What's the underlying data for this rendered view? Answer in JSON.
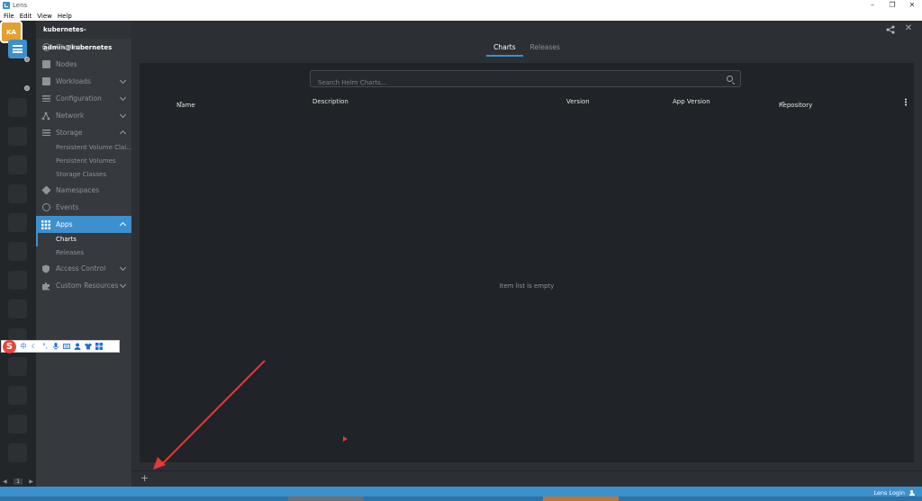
{
  "window": {
    "title": "Lens",
    "controls": {
      "minimize": "–",
      "maximize": "❐",
      "close": "✕"
    }
  },
  "menubar": [
    "File",
    "Edit",
    "View",
    "Help"
  ],
  "hotbar": {
    "cluster_badge": "KA",
    "pager": {
      "prev": "◀",
      "page": "1",
      "next": "▶"
    }
  },
  "sidebar": {
    "cluster_name": "kubernetes-admin@kubernetes",
    "items": [
      {
        "label": "Cluster",
        "icon": "cluster-icon"
      },
      {
        "label": "Nodes",
        "icon": "nodes-icon"
      },
      {
        "label": "Workloads",
        "icon": "workloads-icon",
        "expandable": true
      },
      {
        "label": "Configuration",
        "icon": "configuration-icon",
        "expandable": true
      },
      {
        "label": "Network",
        "icon": "network-icon",
        "expandable": true
      },
      {
        "label": "Storage",
        "icon": "storage-icon",
        "expanded": true,
        "children": [
          "Persistent Volume Clai...",
          "Persistent Volumes",
          "Storage Classes"
        ]
      },
      {
        "label": "Namespaces",
        "icon": "namespaces-icon"
      },
      {
        "label": "Events",
        "icon": "events-icon"
      },
      {
        "label": "Apps",
        "icon": "apps-icon",
        "expanded": true,
        "active": true,
        "children": [
          "Charts",
          "Releases"
        ]
      },
      {
        "label": "Access Control",
        "icon": "access-control-icon",
        "expandable": true
      },
      {
        "label": "Custom Resources",
        "icon": "custom-resources-icon",
        "expandable": true
      }
    ]
  },
  "main": {
    "tabs": [
      {
        "label": "Charts",
        "active": true
      },
      {
        "label": "Releases",
        "active": false
      }
    ],
    "search": {
      "placeholder": "Search Helm Charts..."
    },
    "columns": [
      "Name",
      "Description",
      "Version",
      "App Version",
      "Repository"
    ],
    "empty_message": "Item list is empty",
    "add_tab": "+"
  },
  "statusbar": {
    "login": "Lens Login"
  },
  "ime_toolbar": {
    "logo": "S",
    "mode": "中",
    "items": [
      "moon-icon",
      "punctuation-icon",
      "mic-icon",
      "keyboard-icon",
      "user-icon",
      "shirt-icon",
      "grid-icon"
    ]
  },
  "colors": {
    "accent": "#3d90ce",
    "sidebar_bg": "#36393e",
    "panel_bg": "#202327",
    "cluster_badge": "#e1a233",
    "annotation_arrow": "#e53935"
  }
}
